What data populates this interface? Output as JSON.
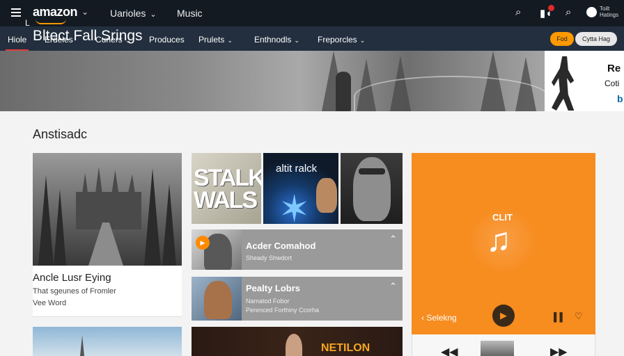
{
  "header": {
    "logo": "amazon",
    "nav": [
      {
        "label": "Uarioles"
      },
      {
        "label": "Music"
      }
    ],
    "account_line1": "Toilt",
    "account_line2": "Hatings"
  },
  "subnav": {
    "items": [
      "Hiole",
      "Erdeles",
      "Cuners",
      "Produces",
      "Prulets",
      "Enthnodls",
      "Freporcles"
    ],
    "pill_primary": "Fod",
    "pill_secondary": "Cytta Hag"
  },
  "hero": {
    "small": "L",
    "title": "Bltect Fall Srings",
    "promo_line1": "Re",
    "promo_line2": "Coti",
    "promo_line3": "b"
  },
  "section": {
    "title": "Anstisadc"
  },
  "card_left": {
    "title": "Ancle Lusr Eying",
    "sub1": "That sgeunes of Fromler",
    "sub2": "Vee Word"
  },
  "tiles": {
    "tile1_text_line1": "STALK",
    "tile1_text_line2": "WALS",
    "tile2_caption": "altit ralck"
  },
  "list": [
    {
      "title": "Acder Comahod",
      "sub1": "Sheady Shwdort"
    },
    {
      "title": "Pealty Lobrs",
      "sub1": "Namatod Fobor",
      "sub2": "Perenced Forthiny Ccorha"
    }
  ],
  "mid_bottom": {
    "label": "NETILON"
  },
  "player": {
    "label": "CLIT",
    "back_label": "Selekng"
  },
  "colors": {
    "header_bg": "#131a22",
    "subnav_bg": "#232f3e",
    "accent_orange": "#f78c1f",
    "active_underline": "#e43b3b"
  },
  "icons": [
    "menu-icon",
    "search-icon",
    "notification-icon",
    "account-icon",
    "music-note-icon",
    "play-icon",
    "pause-bars-icon",
    "heart-icon",
    "chevron-down-icon",
    "chevron-up-icon",
    "back-arrow-icon"
  ]
}
